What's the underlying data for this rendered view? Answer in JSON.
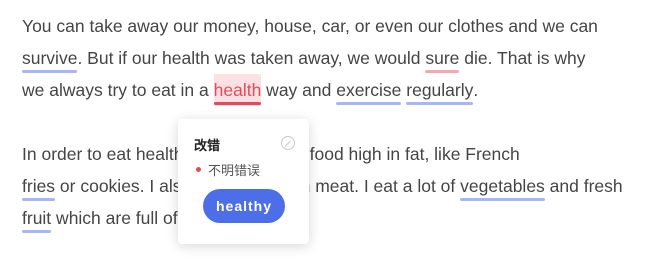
{
  "paragraph1": {
    "line1": [
      "You can take away our money, house, car, or even our clothes and we can"
    ],
    "line2": [
      "survive",
      ". But if our health was taken away, we would ",
      "sure",
      " die. That is why"
    ],
    "line3": [
      "we always try to eat in a ",
      "health",
      " way and ",
      "exercise",
      " ",
      "regularly",
      "."
    ]
  },
  "paragraph2": {
    "line1": [
      "In order to eat healthy, I avoid eating food high in fat, like French"
    ],
    "line2": [
      "fries",
      " or cookies. I also don't eat much meat. I eat a lot of ",
      "vegetables",
      " and fresh"
    ],
    "line3": [
      "fruit",
      " which are full of vitamins."
    ]
  },
  "popup": {
    "title": "改错",
    "error_type": "不明错误",
    "suggestion": "healthy"
  },
  "colors": {
    "underline_blue": "#a9b6f4",
    "underline_red": "#f2a9b3",
    "active_red": "#e34b5b",
    "button_blue": "#4c6fe8"
  }
}
